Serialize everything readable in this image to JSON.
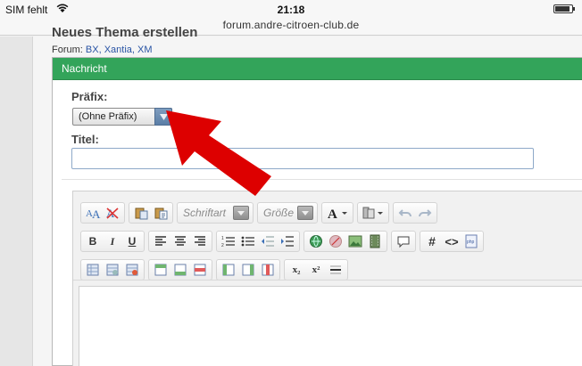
{
  "status": {
    "carrier": "SIM fehlt",
    "time": "21:18",
    "url": "forum.andre-citroen-club.de"
  },
  "page": {
    "title": "Neues Thema erstellen",
    "breadcrumb_prefix": "Forum:",
    "breadcrumb_links": "BX, Xantia, XM"
  },
  "panel": {
    "header": "Nachricht",
    "prefix_label": "Präfix:",
    "prefix_value": "(Ohne Präfix)",
    "title_label": "Titel:",
    "title_value": ""
  },
  "editor": {
    "font_dropdown": "Schriftart",
    "size_dropdown": "Größe",
    "bold": "B",
    "italic": "I",
    "underline": "U",
    "hash": "#",
    "code": "<>",
    "subscript": "x₂",
    "superscript": "x²"
  },
  "colors": {
    "panel_header": "#33a45a",
    "link": "#2a55a5",
    "annotation_arrow": "#dd0000"
  }
}
